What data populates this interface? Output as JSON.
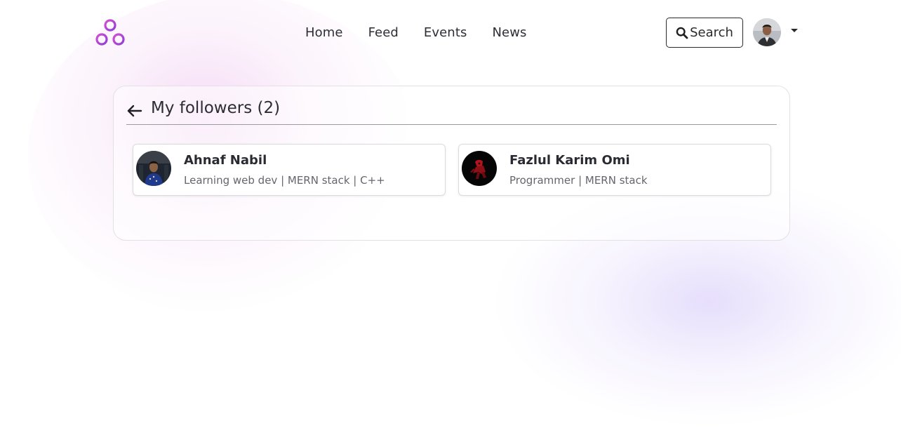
{
  "nav": {
    "items": [
      "Home",
      "Feed",
      "Events",
      "News"
    ],
    "search_label": "Search"
  },
  "followers": {
    "title": "My followers (2)",
    "list": [
      {
        "name": "Ahnaf Nabil",
        "bio": "Learning web dev | MERN stack | C++"
      },
      {
        "name": "Fazlul Karim Omi",
        "bio": "Programmer | MERN stack"
      }
    ]
  },
  "colors": {
    "logo_gradient_start": "#c74bd6",
    "logo_gradient_end": "#8b3fd9",
    "text": "#2b2b33",
    "muted": "#66656d",
    "border": "#e4e0e6"
  },
  "icons": {
    "logo": "triangle-rings-logo",
    "search": "search-icon",
    "back": "arrow-left-icon",
    "caret": "caret-down-icon"
  }
}
